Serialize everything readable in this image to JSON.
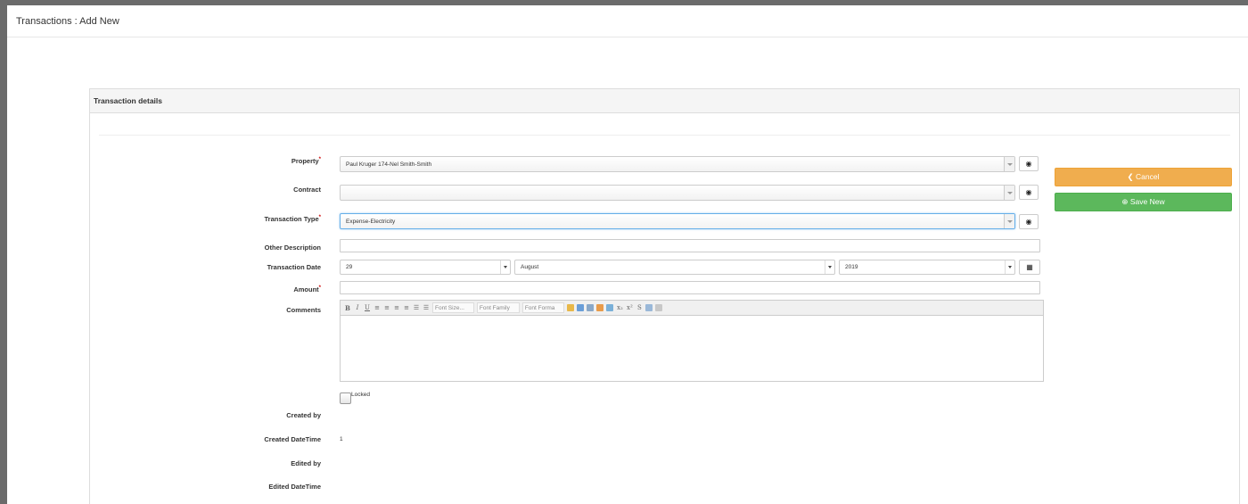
{
  "header": {
    "title": "Transactions : Add New"
  },
  "panel": {
    "title": "Transaction details"
  },
  "form": {
    "property": {
      "label": "Property",
      "required": "*",
      "value": "Paul Kruger 174-Nel Smith-Smith"
    },
    "contract": {
      "label": "Contract",
      "value": ""
    },
    "transaction_type": {
      "label": "Transaction Type",
      "required": "*",
      "value": "Expense-Electricity"
    },
    "other_description": {
      "label": "Other Description",
      "value": ""
    },
    "transaction_date": {
      "label": "Transaction Date",
      "day": "29",
      "month": "August",
      "year": "2019"
    },
    "amount": {
      "label": "Amount",
      "required": "*",
      "value": ""
    },
    "comments": {
      "label": "Comments",
      "toolbar": {
        "bold": "B",
        "italic": "I",
        "underline": "U",
        "font_size": "Font Size...",
        "font_family": "Font Family",
        "font_format": "Font Forma"
      }
    },
    "locked": {
      "label": "Locked",
      "checked": false
    },
    "created_by": {
      "label": "Created by",
      "value": ""
    },
    "created_datetime": {
      "label": "Created DateTime",
      "value": "1"
    },
    "edited_by": {
      "label": "Edited by",
      "value": ""
    },
    "edited_datetime": {
      "label": "Edited DateTime",
      "value": ""
    }
  },
  "actions": {
    "cancel_label": "Cancel",
    "save_label": "Save New"
  },
  "icons": {
    "view": "eye-icon",
    "calendar": "calendar-grid-icon",
    "cancel": "chevron-left-icon",
    "save": "plus-circle-icon"
  },
  "colors": {
    "cancel": "#f0ad4e",
    "save": "#5cb85c",
    "focus": "#66afe9"
  }
}
